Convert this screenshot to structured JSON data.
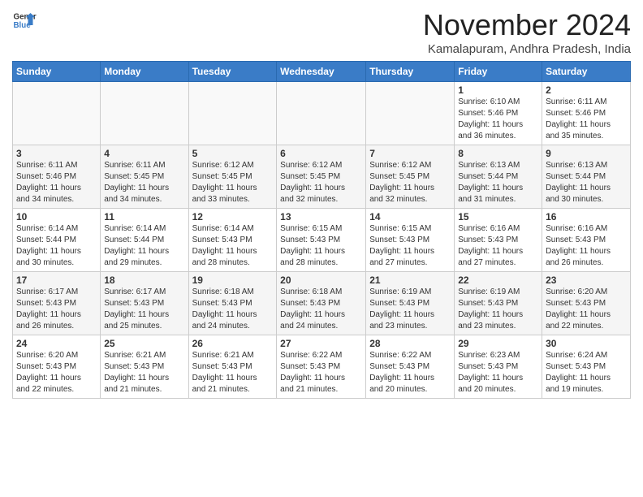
{
  "header": {
    "logo_line1": "General",
    "logo_line2": "Blue",
    "month": "November 2024",
    "location": "Kamalapuram, Andhra Pradesh, India"
  },
  "weekdays": [
    "Sunday",
    "Monday",
    "Tuesday",
    "Wednesday",
    "Thursday",
    "Friday",
    "Saturday"
  ],
  "weeks": [
    [
      {
        "day": "",
        "info": ""
      },
      {
        "day": "",
        "info": ""
      },
      {
        "day": "",
        "info": ""
      },
      {
        "day": "",
        "info": ""
      },
      {
        "day": "",
        "info": ""
      },
      {
        "day": "1",
        "info": "Sunrise: 6:10 AM\nSunset: 5:46 PM\nDaylight: 11 hours\nand 36 minutes."
      },
      {
        "day": "2",
        "info": "Sunrise: 6:11 AM\nSunset: 5:46 PM\nDaylight: 11 hours\nand 35 minutes."
      }
    ],
    [
      {
        "day": "3",
        "info": "Sunrise: 6:11 AM\nSunset: 5:46 PM\nDaylight: 11 hours\nand 34 minutes."
      },
      {
        "day": "4",
        "info": "Sunrise: 6:11 AM\nSunset: 5:45 PM\nDaylight: 11 hours\nand 34 minutes."
      },
      {
        "day": "5",
        "info": "Sunrise: 6:12 AM\nSunset: 5:45 PM\nDaylight: 11 hours\nand 33 minutes."
      },
      {
        "day": "6",
        "info": "Sunrise: 6:12 AM\nSunset: 5:45 PM\nDaylight: 11 hours\nand 32 minutes."
      },
      {
        "day": "7",
        "info": "Sunrise: 6:12 AM\nSunset: 5:45 PM\nDaylight: 11 hours\nand 32 minutes."
      },
      {
        "day": "8",
        "info": "Sunrise: 6:13 AM\nSunset: 5:44 PM\nDaylight: 11 hours\nand 31 minutes."
      },
      {
        "day": "9",
        "info": "Sunrise: 6:13 AM\nSunset: 5:44 PM\nDaylight: 11 hours\nand 30 minutes."
      }
    ],
    [
      {
        "day": "10",
        "info": "Sunrise: 6:14 AM\nSunset: 5:44 PM\nDaylight: 11 hours\nand 30 minutes."
      },
      {
        "day": "11",
        "info": "Sunrise: 6:14 AM\nSunset: 5:44 PM\nDaylight: 11 hours\nand 29 minutes."
      },
      {
        "day": "12",
        "info": "Sunrise: 6:14 AM\nSunset: 5:43 PM\nDaylight: 11 hours\nand 28 minutes."
      },
      {
        "day": "13",
        "info": "Sunrise: 6:15 AM\nSunset: 5:43 PM\nDaylight: 11 hours\nand 28 minutes."
      },
      {
        "day": "14",
        "info": "Sunrise: 6:15 AM\nSunset: 5:43 PM\nDaylight: 11 hours\nand 27 minutes."
      },
      {
        "day": "15",
        "info": "Sunrise: 6:16 AM\nSunset: 5:43 PM\nDaylight: 11 hours\nand 27 minutes."
      },
      {
        "day": "16",
        "info": "Sunrise: 6:16 AM\nSunset: 5:43 PM\nDaylight: 11 hours\nand 26 minutes."
      }
    ],
    [
      {
        "day": "17",
        "info": "Sunrise: 6:17 AM\nSunset: 5:43 PM\nDaylight: 11 hours\nand 26 minutes."
      },
      {
        "day": "18",
        "info": "Sunrise: 6:17 AM\nSunset: 5:43 PM\nDaylight: 11 hours\nand 25 minutes."
      },
      {
        "day": "19",
        "info": "Sunrise: 6:18 AM\nSunset: 5:43 PM\nDaylight: 11 hours\nand 24 minutes."
      },
      {
        "day": "20",
        "info": "Sunrise: 6:18 AM\nSunset: 5:43 PM\nDaylight: 11 hours\nand 24 minutes."
      },
      {
        "day": "21",
        "info": "Sunrise: 6:19 AM\nSunset: 5:43 PM\nDaylight: 11 hours\nand 23 minutes."
      },
      {
        "day": "22",
        "info": "Sunrise: 6:19 AM\nSunset: 5:43 PM\nDaylight: 11 hours\nand 23 minutes."
      },
      {
        "day": "23",
        "info": "Sunrise: 6:20 AM\nSunset: 5:43 PM\nDaylight: 11 hours\nand 22 minutes."
      }
    ],
    [
      {
        "day": "24",
        "info": "Sunrise: 6:20 AM\nSunset: 5:43 PM\nDaylight: 11 hours\nand 22 minutes."
      },
      {
        "day": "25",
        "info": "Sunrise: 6:21 AM\nSunset: 5:43 PM\nDaylight: 11 hours\nand 21 minutes."
      },
      {
        "day": "26",
        "info": "Sunrise: 6:21 AM\nSunset: 5:43 PM\nDaylight: 11 hours\nand 21 minutes."
      },
      {
        "day": "27",
        "info": "Sunrise: 6:22 AM\nSunset: 5:43 PM\nDaylight: 11 hours\nand 21 minutes."
      },
      {
        "day": "28",
        "info": "Sunrise: 6:22 AM\nSunset: 5:43 PM\nDaylight: 11 hours\nand 20 minutes."
      },
      {
        "day": "29",
        "info": "Sunrise: 6:23 AM\nSunset: 5:43 PM\nDaylight: 11 hours\nand 20 minutes."
      },
      {
        "day": "30",
        "info": "Sunrise: 6:24 AM\nSunset: 5:43 PM\nDaylight: 11 hours\nand 19 minutes."
      }
    ]
  ]
}
